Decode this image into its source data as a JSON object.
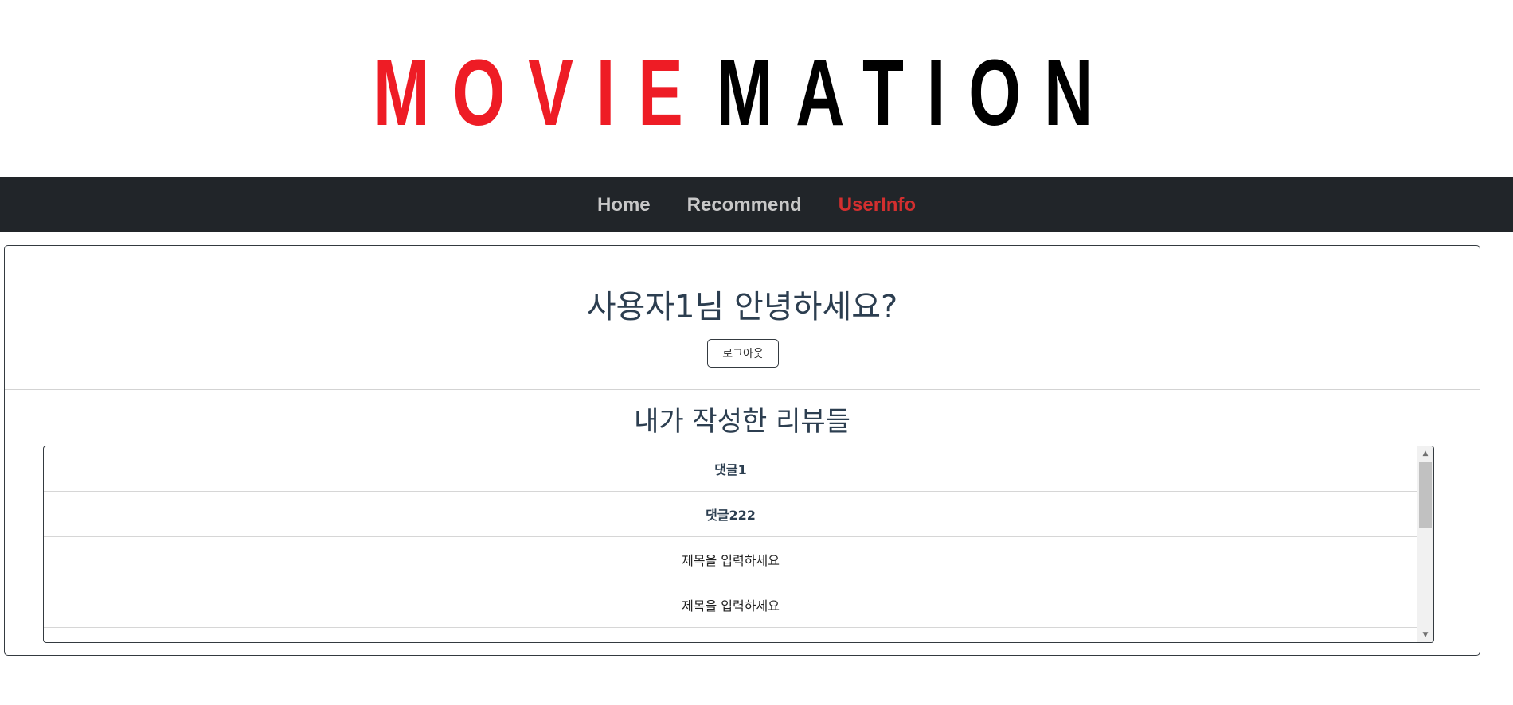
{
  "logo": {
    "word1": "MOVIE",
    "word2": "MATION",
    "colors": {
      "word1": "#ee1c25",
      "word2": "#000000"
    }
  },
  "nav": {
    "items": [
      {
        "label": "Home"
      },
      {
        "label": "Recommend"
      },
      {
        "label": "UserInfo"
      }
    ],
    "active": "UserInfo",
    "active_color": "#d32f2f"
  },
  "user": {
    "greeting": "사용자1님 안녕하세요?",
    "logout_label": "로그아웃"
  },
  "reviews": {
    "title": "내가 작성한 리뷰들",
    "items": [
      {
        "text": "댓글1"
      },
      {
        "text": "댓글222"
      },
      {
        "text": "제목을 입력하세요"
      },
      {
        "text": "제목을 입력하세요"
      }
    ]
  }
}
